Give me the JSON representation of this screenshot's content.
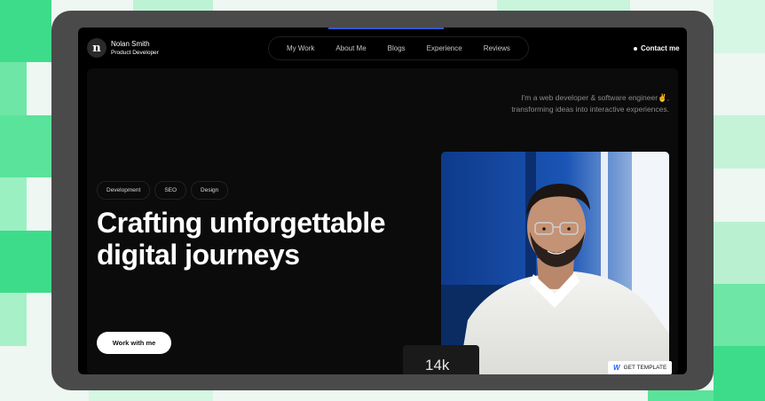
{
  "header": {
    "logo_letter": "n",
    "name": "Nolan Smith",
    "role": "Product Developer",
    "contact_label": "Contact me"
  },
  "nav": {
    "items": [
      {
        "label": "My Work"
      },
      {
        "label": "About Me"
      },
      {
        "label": "Blogs"
      },
      {
        "label": "Experience"
      },
      {
        "label": "Reviews"
      }
    ]
  },
  "hero": {
    "intro": "I'm a web developer & software engineer✌️, transforming ideas into interactive experiences.",
    "tags": [
      "Development",
      "SEO",
      "Design"
    ],
    "headline": "Crafting unforgettable digital journeys",
    "cta_label": "Work with me",
    "stat_value": "14k"
  },
  "badge": {
    "label": "GET TEMPLATE",
    "icon": "webflow-icon"
  },
  "colors": {
    "accent_green": "#3ddc84",
    "page_bg": "#000000",
    "device_frame": "#4a4a4a"
  }
}
